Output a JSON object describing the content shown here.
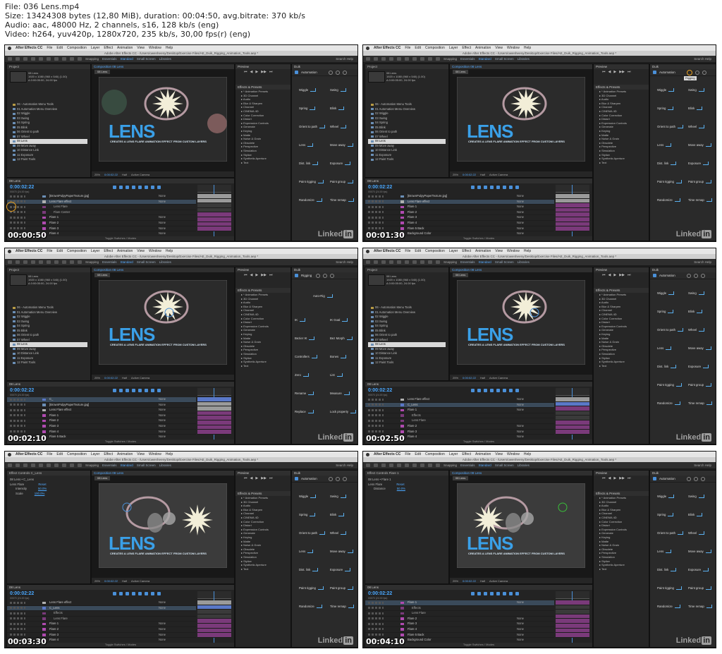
{
  "header": {
    "lines": [
      "File: 036 Lens.mp4",
      "Size: 13424308 bytes (12,80 MiB), duration: 00:04:50, avg.bitrate: 370 kb/s",
      "Audio: aac, 48000 Hz, 2 channels, s16, 128 kb/s (eng)",
      "Video: h264, yuv420p, 1280x720, 235 kb/s, 30,00 fps(r) (eng)"
    ]
  },
  "app": {
    "name": "After Effects CC",
    "menu": [
      "File",
      "Edit",
      "Composition",
      "Layer",
      "Effect",
      "Animation",
      "View",
      "Window",
      "Help"
    ],
    "window_title": "Adobe After Effects CC - /Users/owenheeny/Desktop/Exercise Files/AE_Duik_Rigging_Animation_Tools.aep *",
    "search_help": "Search Help",
    "workspaces": [
      "Essentials",
      "Standard",
      "Small Screen",
      "Libraries"
    ],
    "active_workspace": "Standard",
    "snapping": "Snapping",
    "colors": {
      "accent": "#4aa8ff",
      "selection": "#d9d9d9",
      "highlight_ring": "#e8a020",
      "purple_bar": "#7a3a7a",
      "blue_bar": "#5a78c8"
    }
  },
  "project": {
    "tab": "Project",
    "comp_name": "08 Lens",
    "comp_info": [
      "1920 x 1080 (960 x 540) (1.00)",
      "Δ 0:00:05:00, 24.00 fps"
    ],
    "items": [
      {
        "label": "06 - Automation Menu Tools",
        "type": "folder"
      },
      {
        "label": "01 Automation Menu Overview",
        "type": "comp"
      },
      {
        "label": "02 Wiggle",
        "type": "comp"
      },
      {
        "label": "03 Swing",
        "type": "comp"
      },
      {
        "label": "04 Spring",
        "type": "comp"
      },
      {
        "label": "05 Blink",
        "type": "comp"
      },
      {
        "label": "06 Orient to path",
        "type": "comp"
      },
      {
        "label": "07 Wheel",
        "type": "comp"
      },
      {
        "label": "08 Lens",
        "type": "comp",
        "selected": true
      },
      {
        "label": "09 Move away",
        "type": "comp"
      },
      {
        "label": "10 Distance Link",
        "type": "comp"
      },
      {
        "label": "11 Exposure",
        "type": "comp"
      },
      {
        "label": "12 Paint Tools",
        "type": "comp"
      }
    ]
  },
  "composition": {
    "tab": "Composition 08 Lens",
    "comp_tab": "08 Lens",
    "title_text": "LENS",
    "subtitle_text": "CREATES A LENS FLARE ANIMATION EFFECT FROM CUSTOM LAYERS",
    "zoom": "25%",
    "timecode": "0:00:02:22",
    "resolution": "Half",
    "camera": "Active Camera"
  },
  "effects": {
    "preview_tab": "Preview",
    "tab": "Effects & Presets",
    "items": [
      "* Animation Presets",
      "3D Channel",
      "Audio",
      "Blur & Sharpen",
      "Channel",
      "CINEMA 4D",
      "Color Correction",
      "Distort",
      "Expression Controls",
      "Generate",
      "Keying",
      "Matte",
      "Noise & Grain",
      "Obsolete",
      "Perspective",
      "Simulation",
      "Stylize",
      "Synthetic Aperture",
      "Text"
    ]
  },
  "duik": {
    "tab": "Duik",
    "automation": "Automation",
    "rigging": "Rigging",
    "tooltip": "Rigging",
    "automation_tools": [
      "Wiggle",
      "Swing",
      "Spring",
      "Blink",
      "Orient to path",
      "Wheel",
      "Lens",
      "Move away",
      "Dist. link",
      "Exposure",
      "Paint rigging",
      "Paint group",
      "Randomize",
      "Time remap"
    ],
    "rigging_tools": [
      "Auto-Rig",
      "IK",
      "IK Goal",
      "Bezier IK",
      "Bez Morph",
      "Controllers",
      "Bones",
      "Zero",
      "List",
      "Rename",
      "Measure",
      "Replace",
      "Lock property"
    ]
  },
  "timeline": {
    "tab": "08 Lens",
    "timecode": "0:00:02:22",
    "fps": "00070 (24.00 fps)",
    "footer": "Toggle Switches / Modes",
    "columns": [
      "Layer Name",
      "Parent"
    ],
    "parent_none": "None"
  },
  "frames": [
    {
      "timestamp": "00:00:50",
      "mode": "automation",
      "panel_left": "project",
      "effect_controls_tab": "Effect Controls Lens Flare effe",
      "layers": [
        {
          "name": "[BrownPulpyPaperTexture.jpg]",
          "color": "#6b8fb6"
        },
        {
          "name": "Lens Flare effect",
          "color": "#b0b0b0",
          "selected": true
        },
        {
          "name": "Lens Flare",
          "color": "#7a3a7a",
          "sub": true
        },
        {
          "name": "Flare Center",
          "color": "#7a3a7a",
          "sub": true
        },
        {
          "name": "Flare 1",
          "color": "#b04ab0"
        },
        {
          "name": "Flare 2",
          "color": "#b04ab0"
        },
        {
          "name": "Flare 3",
          "color": "#b04ab0"
        },
        {
          "name": "Flare 4",
          "color": "#b04ab0"
        }
      ]
    },
    {
      "timestamp": "00:01:30",
      "mode": "automation",
      "panel_left": "project",
      "effect_controls_tab": "Effect Controls Lens Flare effe",
      "layers": [
        {
          "name": "[BrownPulpyPaperTexture.jpg]",
          "color": "#6b8fb6"
        },
        {
          "name": "Lens Flare effect",
          "color": "#b0b0b0",
          "selected": true
        },
        {
          "name": "Flare 1",
          "color": "#b04ab0"
        },
        {
          "name": "Flare 2",
          "color": "#b04ab0"
        },
        {
          "name": "Flare 3",
          "color": "#b04ab0"
        },
        {
          "name": "Flare 4",
          "color": "#b04ab0"
        },
        {
          "name": "Flare 5 Back",
          "color": "#b04ab0"
        },
        {
          "name": "Background Color",
          "color": "#b04ab0"
        }
      ]
    },
    {
      "timestamp": "00:02:10",
      "mode": "rigging",
      "panel_left": "project",
      "effect_controls_tab": "Effect Controls C_",
      "layers": [
        {
          "name": "C_",
          "color": "#5a78c8",
          "selected": true
        },
        {
          "name": "[BrownPulpyPaperTexture.jpg]",
          "color": "#6b8fb6"
        },
        {
          "name": "Lens Flare effect",
          "color": "#b0b0b0"
        },
        {
          "name": "Flare 1",
          "color": "#b04ab0"
        },
        {
          "name": "Flare 2",
          "color": "#b04ab0"
        },
        {
          "name": "Flare 3",
          "color": "#b04ab0"
        },
        {
          "name": "Flare 4",
          "color": "#b04ab0"
        },
        {
          "name": "Flare 5 Back",
          "color": "#b04ab0"
        }
      ]
    },
    {
      "timestamp": "00:02:50",
      "mode": "automation",
      "panel_left": "project",
      "effect_controls_tab": "Effect Controls C_Lens",
      "layers": [
        {
          "name": "Lens Flare effect",
          "color": "#b0b0b0"
        },
        {
          "name": "C_Lens",
          "color": "#5a78c8",
          "selected": true
        },
        {
          "name": "Flare 1",
          "color": "#b04ab0"
        },
        {
          "name": "Effects",
          "color": "#7a3a7a",
          "sub": true
        },
        {
          "name": "Lens Flare",
          "color": "#7a3a7a",
          "sub": true
        },
        {
          "name": "Flare 2",
          "color": "#b04ab0"
        },
        {
          "name": "Flare 3",
          "color": "#b04ab0"
        },
        {
          "name": "Flare 4",
          "color": "#b04ab0"
        }
      ]
    },
    {
      "timestamp": "00:03:30",
      "mode": "automation",
      "panel_left": "effect_controls",
      "effect_controls_tab": "Effect Controls C_Lens",
      "effect_controls": {
        "layer": "08 Lens • C_Lens",
        "effect": "Lens Flare",
        "reset": "Reset",
        "props": [
          {
            "name": "Intensity",
            "value": "50.0%"
          },
          {
            "name": "Scale",
            "value": "100.0%"
          }
        ]
      },
      "layers": [
        {
          "name": "Lens Flare effect",
          "color": "#b0b0b0"
        },
        {
          "name": "C_Lens",
          "color": "#5a78c8",
          "selected": true
        },
        {
          "name": "Effects",
          "color": "#7a3a7a",
          "sub": true
        },
        {
          "name": "Lens Flare",
          "color": "#7a3a7a",
          "sub": true
        },
        {
          "name": "Flare 1",
          "color": "#b04ab0"
        },
        {
          "name": "Flare 2",
          "color": "#b04ab0"
        },
        {
          "name": "Flare 3",
          "color": "#b04ab0"
        },
        {
          "name": "Flare 4",
          "color": "#b04ab0"
        }
      ]
    },
    {
      "timestamp": "00:04:10",
      "mode": "automation",
      "panel_left": "effect_controls",
      "effect_controls_tab": "Effect Controls Flare 1",
      "effect_controls": {
        "layer": "08 Lens • Flare 1",
        "effect": "Lens Flare",
        "reset": "Reset",
        "props": [
          {
            "name": "Distance",
            "value": "50.0%"
          }
        ]
      },
      "layers": [
        {
          "name": "Flare 1",
          "color": "#b04ab0",
          "selected": true
        },
        {
          "name": "Effects",
          "color": "#7a3a7a",
          "sub": true
        },
        {
          "name": "Lens Flare",
          "color": "#7a3a7a",
          "sub": true
        },
        {
          "name": "Flare 2",
          "color": "#b04ab0"
        },
        {
          "name": "Flare 3",
          "color": "#b04ab0"
        },
        {
          "name": "Flare 4",
          "color": "#b04ab0"
        },
        {
          "name": "Flare 5 Back",
          "color": "#b04ab0"
        },
        {
          "name": "Background Color",
          "color": "#b04ab0"
        }
      ]
    }
  ],
  "watermark": {
    "text": "Linked",
    "badge": "in"
  }
}
